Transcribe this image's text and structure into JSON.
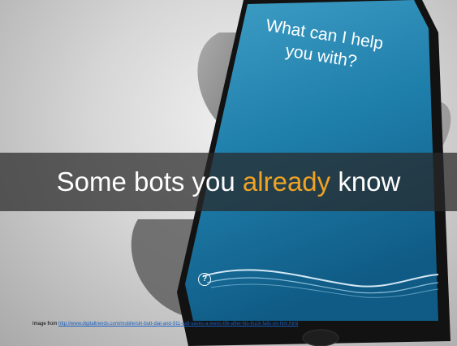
{
  "slide": {
    "screen_prompt": "What can I help you with?",
    "headline": {
      "before": "Some bots you ",
      "accent": "already",
      "after": " know",
      "accent_color": "#f0a323"
    },
    "help_icon": "question-mark-icon",
    "credit": {
      "prefix": "Image from ",
      "link_text": "http://www.digitaltrends.com/mobile/siri-butt-dial-and-911-call-saves-a-teens-life-after-his-truck-falls-on-him.html"
    }
  }
}
